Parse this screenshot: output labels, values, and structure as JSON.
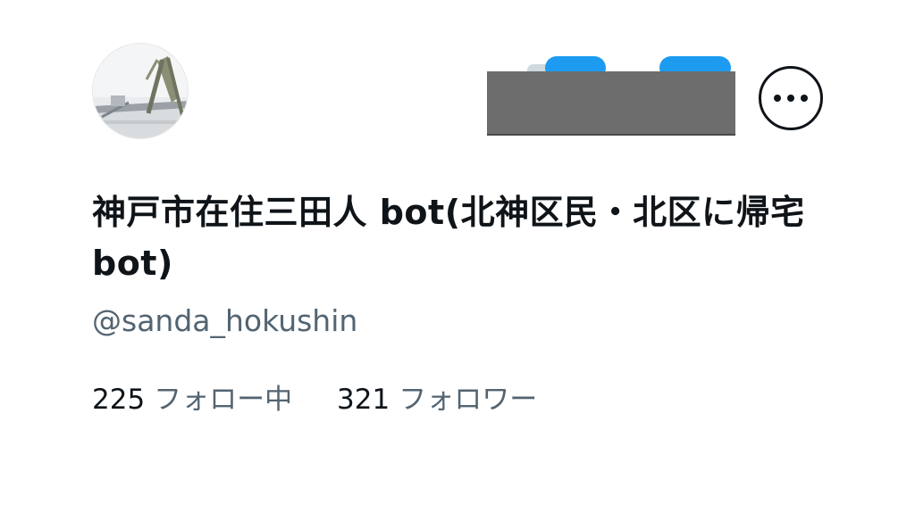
{
  "profile": {
    "display_name": "神戸市在住三田人 bot(北神区民・北区に帰宅 bot)",
    "handle": "@sanda_hokushin",
    "avatar_icon": "bridge-photo-avatar"
  },
  "header": {
    "more_icon": "ellipsis-icon"
  },
  "stats": {
    "following_count": "225",
    "following_label": "フォロー中",
    "followers_count": "321",
    "followers_label": "フォロワー"
  },
  "colors": {
    "text_primary": "#0f1419",
    "text_secondary": "#536471",
    "accent": "#1d9bf0",
    "redaction": "#6d6d6d"
  }
}
